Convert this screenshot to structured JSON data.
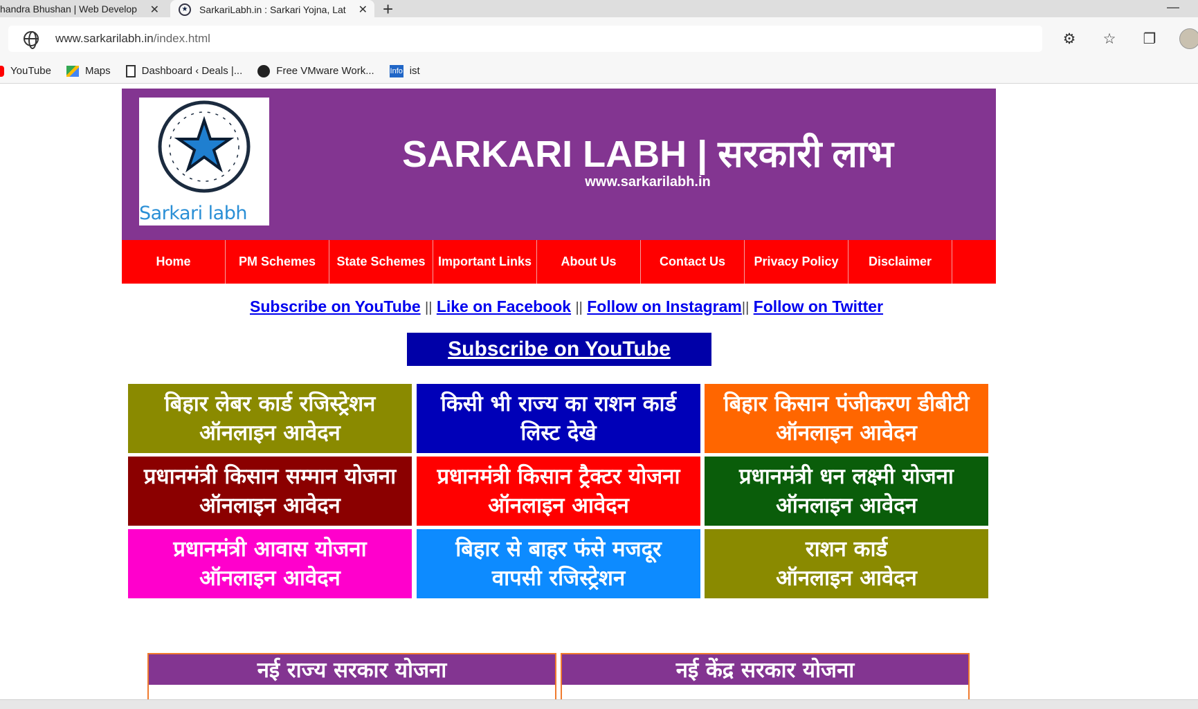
{
  "browser": {
    "tabs": [
      {
        "title": "handra Bhushan | Web Develop",
        "close": "✕"
      },
      {
        "title": "SarkariLabh.in : Sarkari Yojna, Lat",
        "close": "✕"
      }
    ],
    "new_tab": "+",
    "minimize": "—",
    "url_host": "www.sarkarilabh.in",
    "url_path": "/index.html",
    "bookmarks": [
      {
        "label": "YouTube",
        "icon": "youtube-icon"
      },
      {
        "label": "Maps",
        "icon": "maps-icon"
      },
      {
        "label": "Dashboard ‹ Deals |...",
        "icon": "document-icon"
      },
      {
        "label": "Free VMware Work...",
        "icon": "github-icon"
      },
      {
        "label": "ist",
        "icon": "info-icon"
      }
    ],
    "bookmark_info_badge": "Info"
  },
  "header": {
    "logo_caption": "Sarkari labh",
    "title": "SARKARI LABH | सरकारी लाभ",
    "url": "www.sarkarilabh.in",
    "bg_color": "#833591"
  },
  "nav": {
    "items": [
      "Home",
      "PM Schemes",
      "State Schemes",
      "Important Links",
      "About Us",
      "Contact Us",
      "Privacy Policy",
      "Disclaimer"
    ],
    "bg_color": "#ff0000"
  },
  "social": {
    "youtube": "Subscribe on YouTube",
    "sep1": "||",
    "facebook": "Like on Facebook",
    "sep2": "||",
    "instagram": "Follow on Instagram",
    "sep3": "||",
    "twitter": "Follow on Twitter"
  },
  "subscribe_box": "Subscribe on YouTube",
  "tiles": [
    {
      "line1": "बिहार लेबर कार्ड रजिस्ट्रेशन",
      "line2": "ऑनलाइन आवेदन",
      "color": "#8a8a00"
    },
    {
      "line1": "किसी भी राज्य का राशन कार्ड",
      "line2": "लिस्ट देखे",
      "color": "#0000b8"
    },
    {
      "line1": "बिहार किसान पंजीकरण डीबीटी",
      "line2": "ऑनलाइन आवेदन",
      "color": "#ff6600"
    },
    {
      "line1": "प्रधानमंत्री किसान सम्मान योजना",
      "line2": "ऑनलाइन आवेदन",
      "color": "#8b0000"
    },
    {
      "line1": "प्रधानमंत्री किसान ट्रैक्टर योजना",
      "line2": "ऑनलाइन आवेदन",
      "color": "#ff0000"
    },
    {
      "line1": "प्रधानमंत्री धन लक्ष्मी योजना",
      "line2": "ऑनलाइन आवेदन",
      "color": "#0a5d0a"
    },
    {
      "line1": "प्रधानमंत्री आवास योजना",
      "line2": "ऑनलाइन आवेदन",
      "color": "#ff00cc"
    },
    {
      "line1": "बिहार से बाहर फंसे मजदूर",
      "line2": "वापसी रजिस्ट्रेशन",
      "color": "#0d8bff"
    },
    {
      "line1": "राशन कार्ड",
      "line2": "ऑनलाइन आवेदन",
      "color": "#8a8a00"
    }
  ],
  "panels": [
    {
      "title": "नई राज्य सरकार योजना"
    },
    {
      "title": "नई केंद्र सरकार योजना"
    }
  ]
}
